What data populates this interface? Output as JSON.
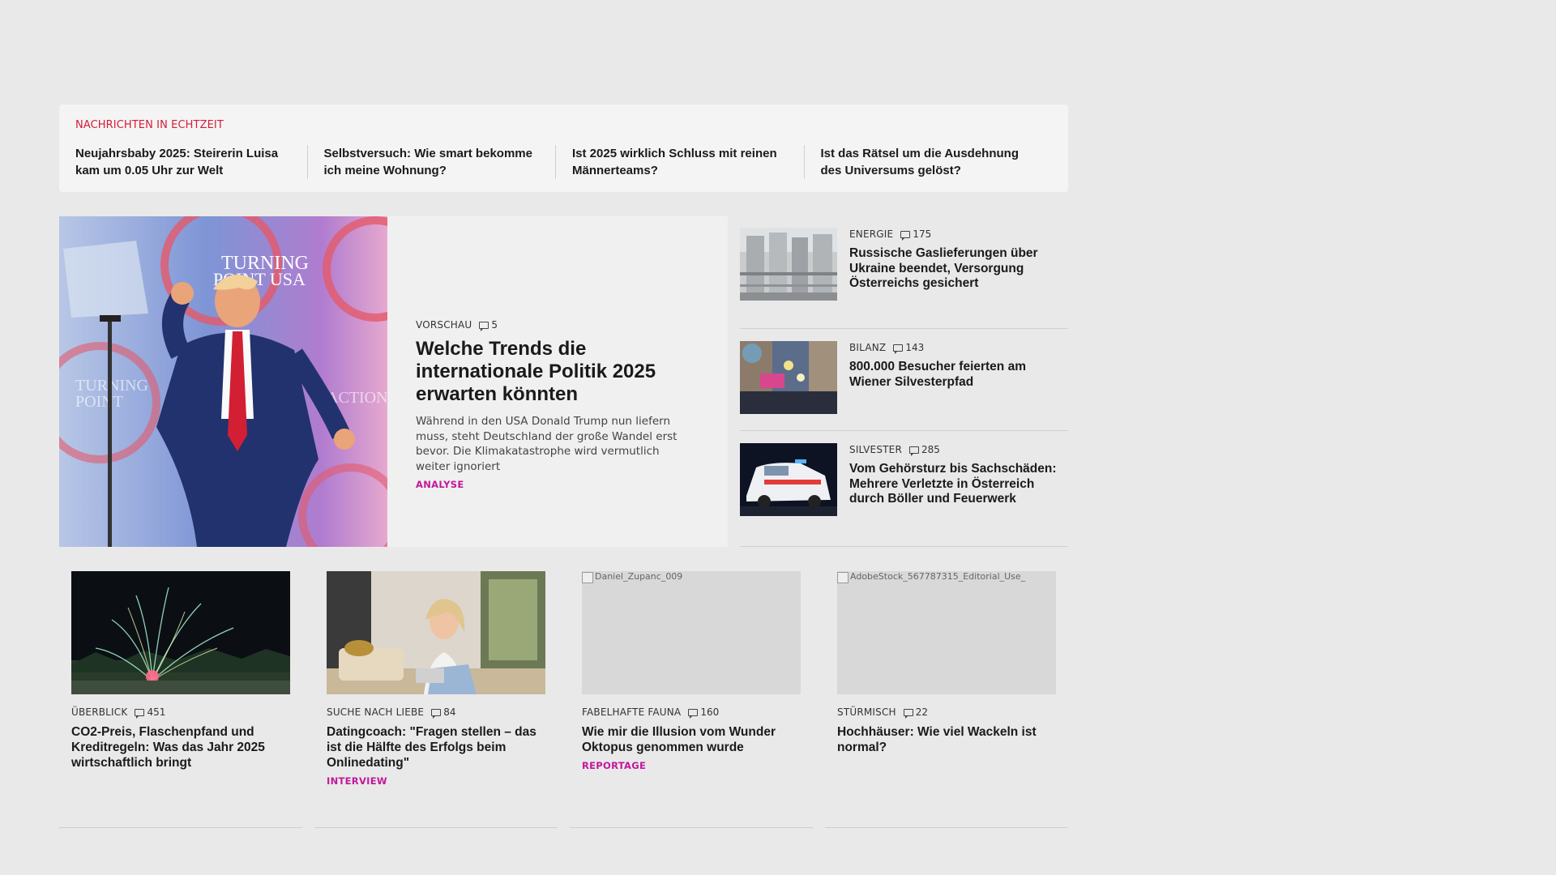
{
  "ticker": {
    "label": "NACHRICHTEN IN ECHTZEIT",
    "items": [
      "Neujahrsbaby 2025: Steirerin Luisa kam um 0.05 Uhr zur Welt",
      "Selbstversuch: Wie smart bekomme ich meine Wohnung?",
      "Ist 2025 wirklich Schluss mit reinen Männerteams?",
      "Ist das Rätsel um die Ausdehnung des Universums gelöst?"
    ]
  },
  "lead": {
    "category": "VORSCHAU",
    "comments": "5",
    "title": "Welche Trends die internationale Politik 2025 erwarten könnten",
    "text": "Während in den USA Donald Trump nun liefern muss, steht Deutschland der große Wandel erst bevor. Die Klimakatastrophe wird vermutlich weiter ignoriert",
    "tag": "ANALYSE",
    "image_text": [
      "TURNING",
      "POINT USA",
      "TURNING",
      "POINT",
      "ACTION"
    ]
  },
  "side": [
    {
      "category": "ENERGIE",
      "comments": "175",
      "title": "Russische Gaslieferungen über Ukraine beendet, Versorgung Österreichs gesichert"
    },
    {
      "category": "BILANZ",
      "comments": "143",
      "title": "800.000 Besucher feierten am Wiener Silvesterpfad"
    },
    {
      "category": "SILVESTER",
      "comments": "285",
      "title": "Vom Gehörsturz bis Sachschäden: Mehrere Verletzte in Österreich durch Böller und Feuerwerk"
    }
  ],
  "cards": [
    {
      "category": "ÜBERBLICK",
      "comments": "451",
      "title": "CO2-Preis, Flaschenpfand und Kreditregeln: Was das Jahr 2025 wirtschaftlich bringt",
      "tag": ""
    },
    {
      "category": "SUCHE NACH LIEBE",
      "comments": "84",
      "title": "Datingcoach: \"Fragen stellen – das ist die Hälfte des Erfolgs beim Onlinedating\"",
      "tag": "INTERVIEW"
    },
    {
      "category": "FABELHAFTE FAUNA",
      "comments": "160",
      "title": "Wie mir die Illusion vom Wunder Oktopus genommen wurde",
      "tag": "REPORTAGE",
      "image_alt": "Daniel_Zupanc_009"
    },
    {
      "category": "STÜRMISCH",
      "comments": "22",
      "title": "Hochhäuser: Wie viel Wackeln ist normal?",
      "tag": "",
      "image_alt": "AdobeStock_567787315_Editorial_Use_"
    }
  ],
  "colors": {
    "page_bg": "#e9e9e9",
    "ticker_label": "#d41c3a",
    "tag": "#c2179b"
  }
}
